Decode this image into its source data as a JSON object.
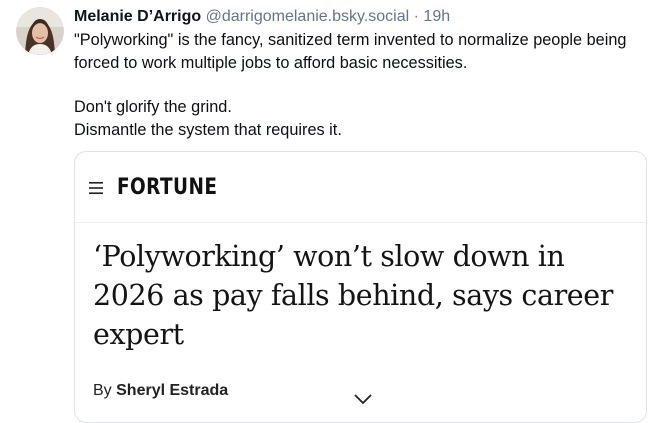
{
  "post": {
    "author_name": "Melanie D’Arrigo",
    "handle": "@darrigomelanie.bsky.social",
    "separator": "·",
    "time": "19h",
    "paragraphs": [
      "\"Polyworking\" is the fancy, sanitized term invented to normalize people being forced to work multiple jobs to afford basic necessities.",
      "Don't glorify the grind.\nDismantle the system that requires it."
    ]
  },
  "card": {
    "logo": "FORTUNE",
    "headline": "‘Polyworking’ won’t slow down in 2026 as pay falls behind, says career expert",
    "byline_prefix": "By",
    "author": "Sheryl Estrada"
  },
  "colors": {
    "name": "#0f1419",
    "meta": "#66748a",
    "card_border": "#dde3ea"
  },
  "icons": [
    "avatar",
    "hamburger-menu-icon",
    "chevron-down-icon"
  ]
}
